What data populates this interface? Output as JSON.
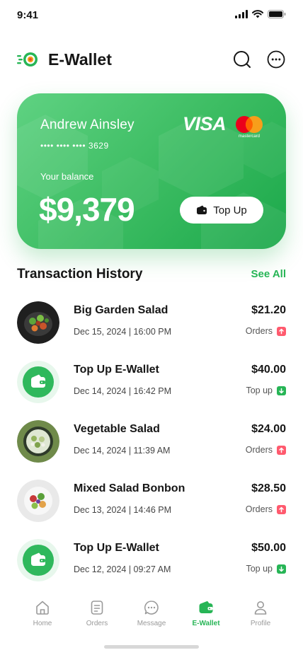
{
  "status_bar": {
    "time": "9:41"
  },
  "header": {
    "title": "E-Wallet"
  },
  "card": {
    "holder_name": "Andrew Ainsley",
    "number_masked": "•••• •••• •••• 3629",
    "brand_visa": "VISA",
    "brand_mastercard": "mastercard",
    "balance_label": "Your balance",
    "balance": "$9,379",
    "topup_label": "Top Up"
  },
  "transactions": {
    "title": "Transaction History",
    "see_all": "See All",
    "items": [
      {
        "title": "Big Garden Salad",
        "date": "Dec 15, 2024 | 16:00 PM",
        "amount": "$21.20",
        "type": "Orders",
        "direction": "up",
        "icon": "food-image"
      },
      {
        "title": "Top Up E-Wallet",
        "date": "Dec 14, 2024 | 16:42 PM",
        "amount": "$40.00",
        "type": "Top up",
        "direction": "down",
        "icon": "wallet-icon"
      },
      {
        "title": "Vegetable Salad",
        "date": "Dec 14, 2024 | 11:39 AM",
        "amount": "$24.00",
        "type": "Orders",
        "direction": "up",
        "icon": "food-image"
      },
      {
        "title": "Mixed Salad Bonbon",
        "date": "Dec 13, 2024 | 14:46 PM",
        "amount": "$28.50",
        "type": "Orders",
        "direction": "up",
        "icon": "food-image"
      },
      {
        "title": "Top Up E-Wallet",
        "date": "Dec 12, 2024 | 09:27 AM",
        "amount": "$50.00",
        "type": "Top up",
        "direction": "down",
        "icon": "wallet-icon"
      }
    ]
  },
  "bottom_nav": {
    "items": [
      {
        "label": "Home",
        "icon": "home-icon",
        "active": false
      },
      {
        "label": "Orders",
        "icon": "document-icon",
        "active": false
      },
      {
        "label": "Message",
        "icon": "chat-icon",
        "active": false
      },
      {
        "label": "E-Wallet",
        "icon": "wallet-icon",
        "active": true
      },
      {
        "label": "Profile",
        "icon": "profile-icon",
        "active": false
      }
    ]
  },
  "colors": {
    "accent": "#27b556",
    "card_gradient_start": "#5fd282",
    "card_gradient_end": "#1ba84a",
    "orders_badge": "#ff5a6e",
    "topup_badge": "#27b556"
  }
}
